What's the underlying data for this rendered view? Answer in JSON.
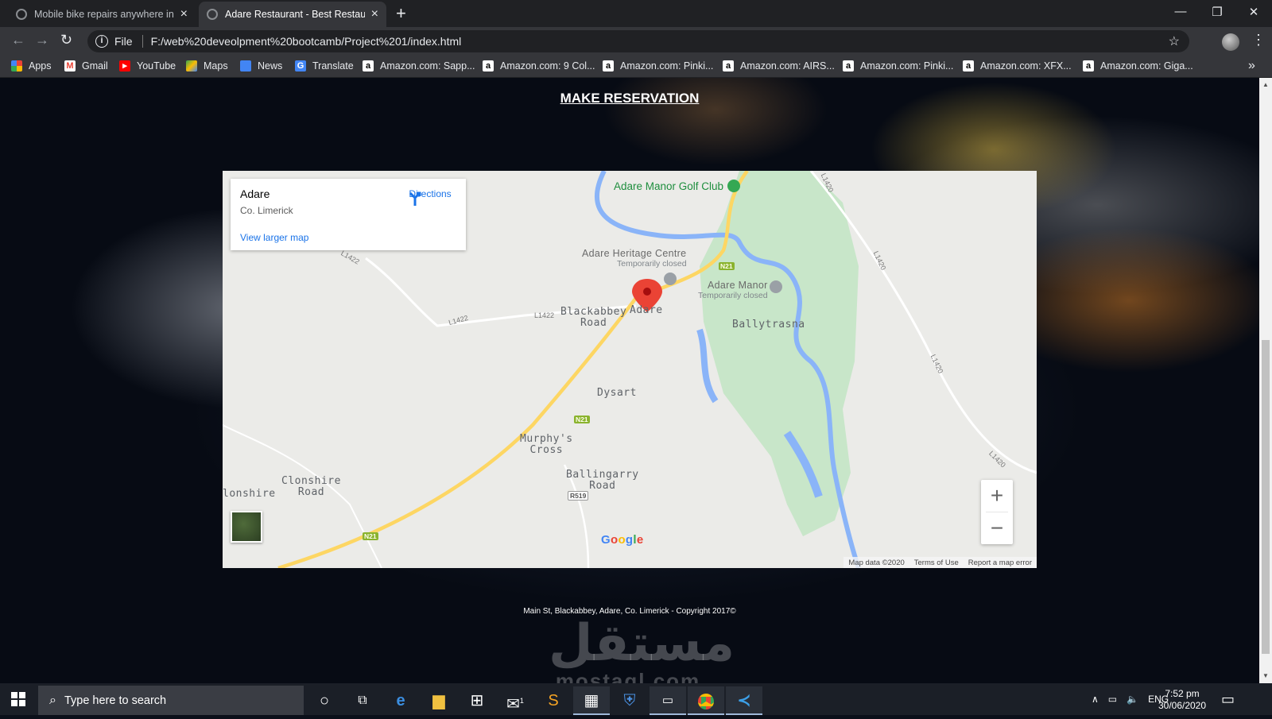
{
  "browser": {
    "tabs": [
      {
        "title": "Mobile bike repairs anywhere in",
        "active": false
      },
      {
        "title": "Adare Restaurant - Best Restaura",
        "active": true
      }
    ],
    "new_tab_icon": "+",
    "address": {
      "scheme_label": "File",
      "url": "F:/web%20deveolpment%20bootcamb/Project%201/index.html"
    },
    "bookmarks": [
      {
        "label": "Apps",
        "icon": "apps-grid"
      },
      {
        "label": "Gmail",
        "icon": "gmail"
      },
      {
        "label": "YouTube",
        "icon": "youtube"
      },
      {
        "label": "Maps",
        "icon": "maps"
      },
      {
        "label": "News",
        "icon": "news"
      },
      {
        "label": "Translate",
        "icon": "translate"
      },
      {
        "label": "Amazon.com: Sapp...",
        "icon": "amazon"
      },
      {
        "label": "Amazon.com: 9 Col...",
        "icon": "amazon"
      },
      {
        "label": "Amazon.com: Pinki...",
        "icon": "amazon"
      },
      {
        "label": "Amazon.com: AIRS...",
        "icon": "amazon"
      },
      {
        "label": "Amazon.com: Pinki...",
        "icon": "amazon"
      },
      {
        "label": "Amazon.com: XFX...",
        "icon": "amazon"
      },
      {
        "label": "Amazon.com: Giga...",
        "icon": "amazon"
      }
    ]
  },
  "page": {
    "reservation_link": "MAKE RESERVATION",
    "footer": "Main St, Blackabbey, Adare, Co. Limerick - Copyright 2017©",
    "watermark_ar": "مستقل",
    "watermark_latin": "mostaql.com"
  },
  "map": {
    "card": {
      "name": "Adare",
      "region": "Co. Limerick",
      "directions": "Directions",
      "larger": "View larger map"
    },
    "labels": {
      "golf": "Adare Manor Golf Club",
      "heritage": "Adare Heritage Centre",
      "heritage_status": "Temporarily closed",
      "manor": "Adare Manor",
      "manor_status": "Temporarily closed",
      "blackabbey": "Blackabbey\nRoad",
      "adare": "Adare",
      "ballytrasna": "Ballytrasna",
      "dysart": "Dysart",
      "murphys": "Murphy's\nCross",
      "ballingarry": "Ballingarry\nRoad",
      "clonshire_road": "Clonshire\nRoad",
      "clonshire": "lonshire"
    },
    "roads": {
      "l1422a": "L1422",
      "l1422b": "L1422",
      "l1422c": "L1422",
      "l1420a": "L1420",
      "l1420b": "L1420",
      "l1420c": "L1420",
      "l1420d": "L1420",
      "n21a": "N21",
      "n21b": "N21",
      "n21c": "N21",
      "r519": "R519"
    },
    "zoom_in": "+",
    "zoom_out": "−",
    "brand": "Google",
    "attribution": [
      "Map data ©2020",
      "Terms of Use",
      "Report a map error"
    ]
  },
  "taskbar": {
    "search_placeholder": "Type here to search",
    "language": "ENG",
    "time": "7:52 pm",
    "date": "30/06/2020",
    "mail_badge": "1"
  },
  "colors": {
    "map_water": "#8ab4f8",
    "map_park": "#c8e6c9",
    "road_major": "#fdd663",
    "pin": "#ea4335"
  }
}
